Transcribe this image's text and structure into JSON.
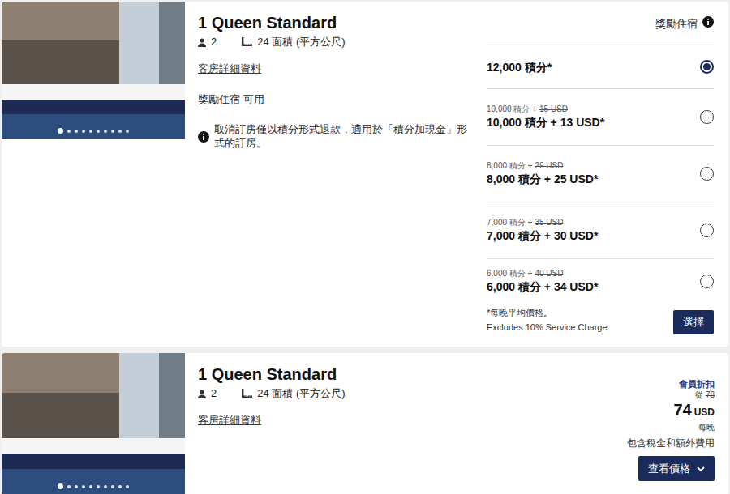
{
  "reward_room": {
    "photo_dots": [
      {
        "selected": true
      },
      {
        "selected": false
      },
      {
        "selected": false
      },
      {
        "selected": false
      },
      {
        "selected": false
      },
      {
        "selected": false
      },
      {
        "selected": false
      },
      {
        "selected": false
      },
      {
        "selected": false
      },
      {
        "selected": false
      }
    ],
    "title": "1 Queen Standard",
    "guests": "2",
    "area": "24 面積 (平方公尺)",
    "details_link": "客房詳細資料",
    "availability": "獎勵住宿 可用",
    "notice": "取消訂房僅以積分形式退款，適用於「積分加現金」形式的訂房。",
    "rate_header": "獎勵住宿",
    "options": [
      {
        "kind": "points",
        "price": "12,000 積分*",
        "selected": true
      },
      {
        "kind": "points_cash",
        "old_points": "10,000 積分 +",
        "old_cash": "15 USD",
        "price": "10,000 積分 + 13 USD*",
        "selected": false
      },
      {
        "kind": "points_cash",
        "old_points": "8,000 積分 +",
        "old_cash": "29 USD",
        "price": "8,000 積分 + 25 USD*",
        "selected": false
      },
      {
        "kind": "points_cash",
        "old_points": "7,000 積分 +",
        "old_cash": "35 USD",
        "price": "7,000 積分 + 30 USD*",
        "selected": false
      },
      {
        "kind": "points_cash",
        "old_points": "6,000 積分 +",
        "old_cash": "40 USD",
        "price": "6,000 積分 + 34 USD*",
        "selected": false
      }
    ],
    "footnotes": [
      "*每晚平均價格。",
      "Excludes 10% Service Charge."
    ],
    "button": "選擇"
  },
  "cash_room": {
    "photo_dots": [
      {
        "selected": true
      },
      {
        "selected": false
      },
      {
        "selected": false
      },
      {
        "selected": false
      },
      {
        "selected": false
      },
      {
        "selected": false
      },
      {
        "selected": false
      },
      {
        "selected": false
      },
      {
        "selected": false
      },
      {
        "selected": false
      }
    ],
    "title": "1 Queen Standard",
    "guests": "2",
    "area": "24 面積 (平方公尺)",
    "details_link": "客房詳細資料",
    "member_label": "會員折扣",
    "from_label": "從",
    "old_price": "78",
    "price": "74",
    "currency": "USD",
    "per_night": "每晚",
    "tax_note": "包含稅金和額外費用",
    "button": "查看價格"
  }
}
